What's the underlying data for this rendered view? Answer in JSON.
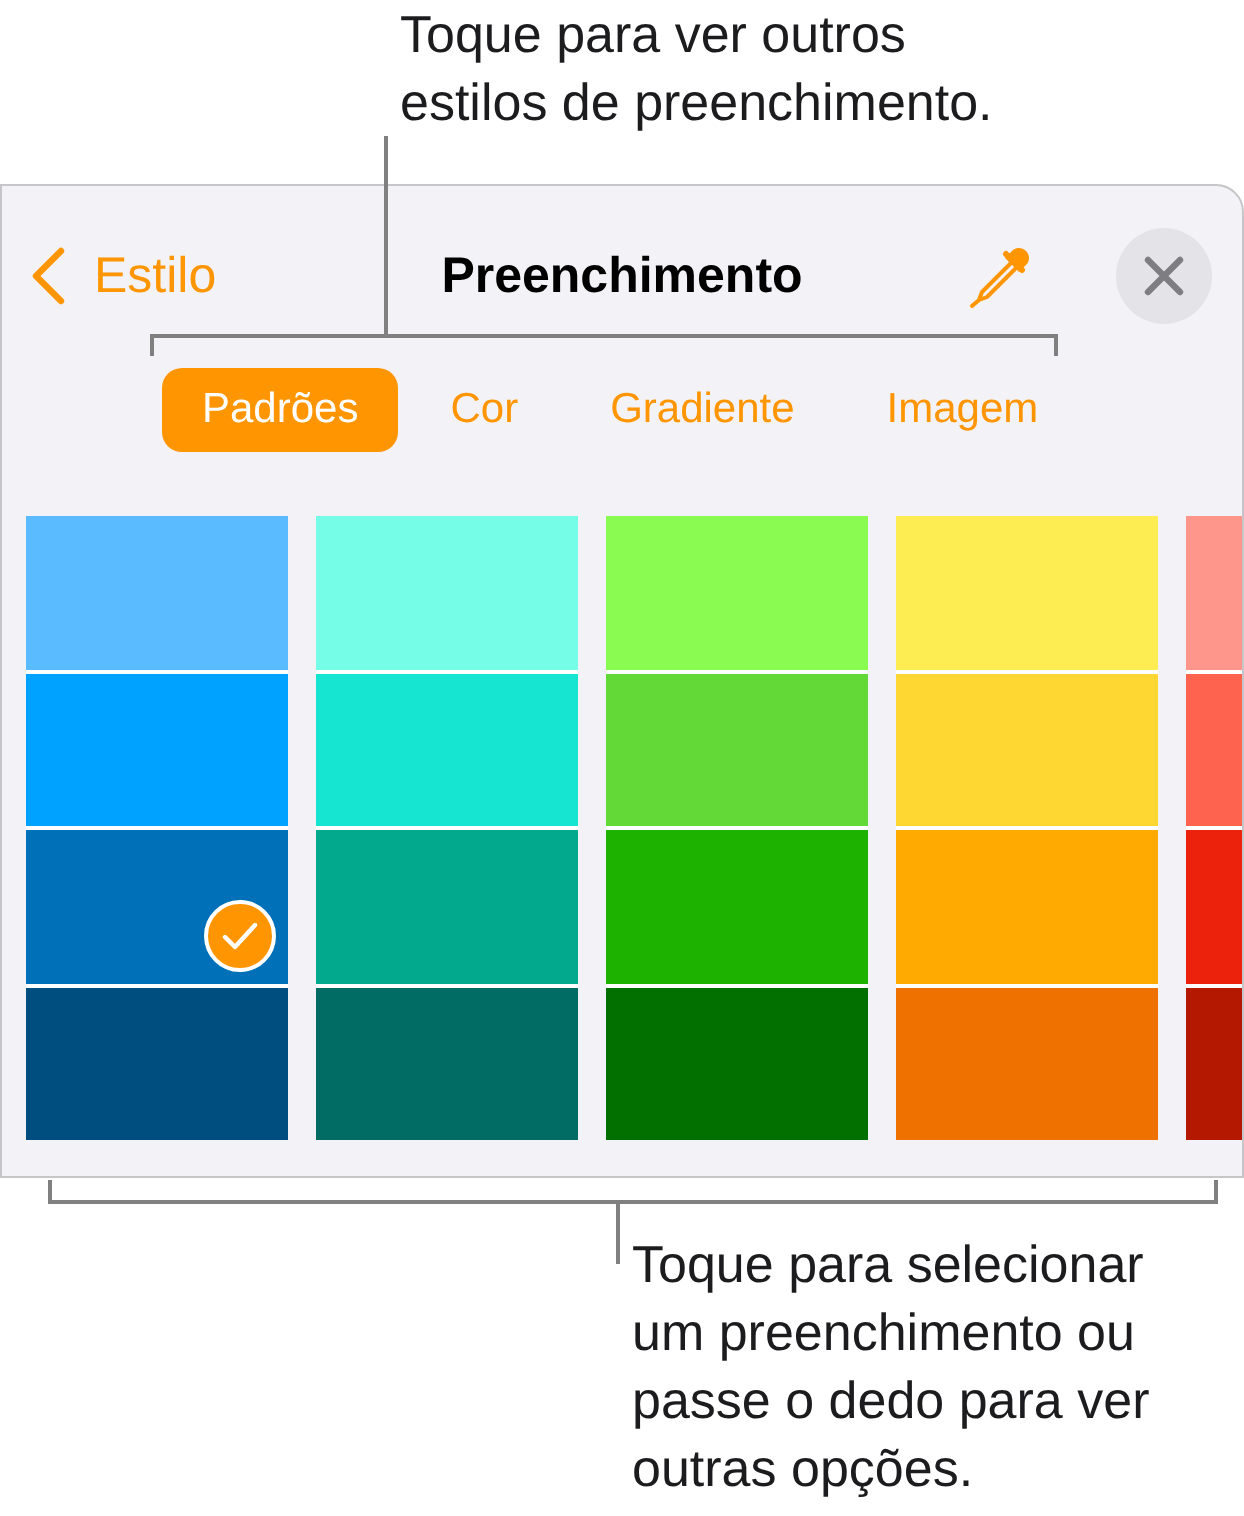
{
  "top_callout": {
    "text": "Toque para ver outros estilos de preenchimento."
  },
  "panel": {
    "back": {
      "label": "Estilo"
    },
    "title": "Preenchimento",
    "tabs": [
      {
        "label": "Padrões",
        "selected": true
      },
      {
        "label": "Cor",
        "selected": false
      },
      {
        "label": "Gradiente",
        "selected": false
      },
      {
        "label": "Imagem",
        "selected": false
      }
    ],
    "swatch_columns": [
      {
        "swatches": [
          {
            "color": "#5abcfe",
            "selected": false
          },
          {
            "color": "#00a2ff",
            "selected": false
          },
          {
            "color": "#0071b8",
            "selected": true
          },
          {
            "color": "#004d80",
            "selected": false
          }
        ]
      },
      {
        "swatches": [
          {
            "color": "#76fde7",
            "selected": false
          },
          {
            "color": "#16e6d1",
            "selected": false
          },
          {
            "color": "#02a98c",
            "selected": false
          },
          {
            "color": "#006c64",
            "selected": false
          }
        ]
      },
      {
        "swatches": [
          {
            "color": "#8afb50",
            "selected": false
          },
          {
            "color": "#62d937",
            "selected": false
          },
          {
            "color": "#1db200",
            "selected": false
          },
          {
            "color": "#027001",
            "selected": false
          }
        ]
      },
      {
        "swatches": [
          {
            "color": "#fded53",
            "selected": false
          },
          {
            "color": "#ffd733",
            "selected": false
          },
          {
            "color": "#feaa00",
            "selected": false
          },
          {
            "color": "#ef7200",
            "selected": false
          }
        ]
      },
      {
        "swatches": [
          {
            "color": "#ff968b",
            "selected": false
          },
          {
            "color": "#fe634f",
            "selected": false
          },
          {
            "color": "#ed220c",
            "selected": false
          },
          {
            "color": "#b51800",
            "selected": false
          }
        ]
      }
    ]
  },
  "bottom_callout": {
    "text": "Toque para selecionar um preenchimento ou passe o dedo para ver outras opções."
  }
}
